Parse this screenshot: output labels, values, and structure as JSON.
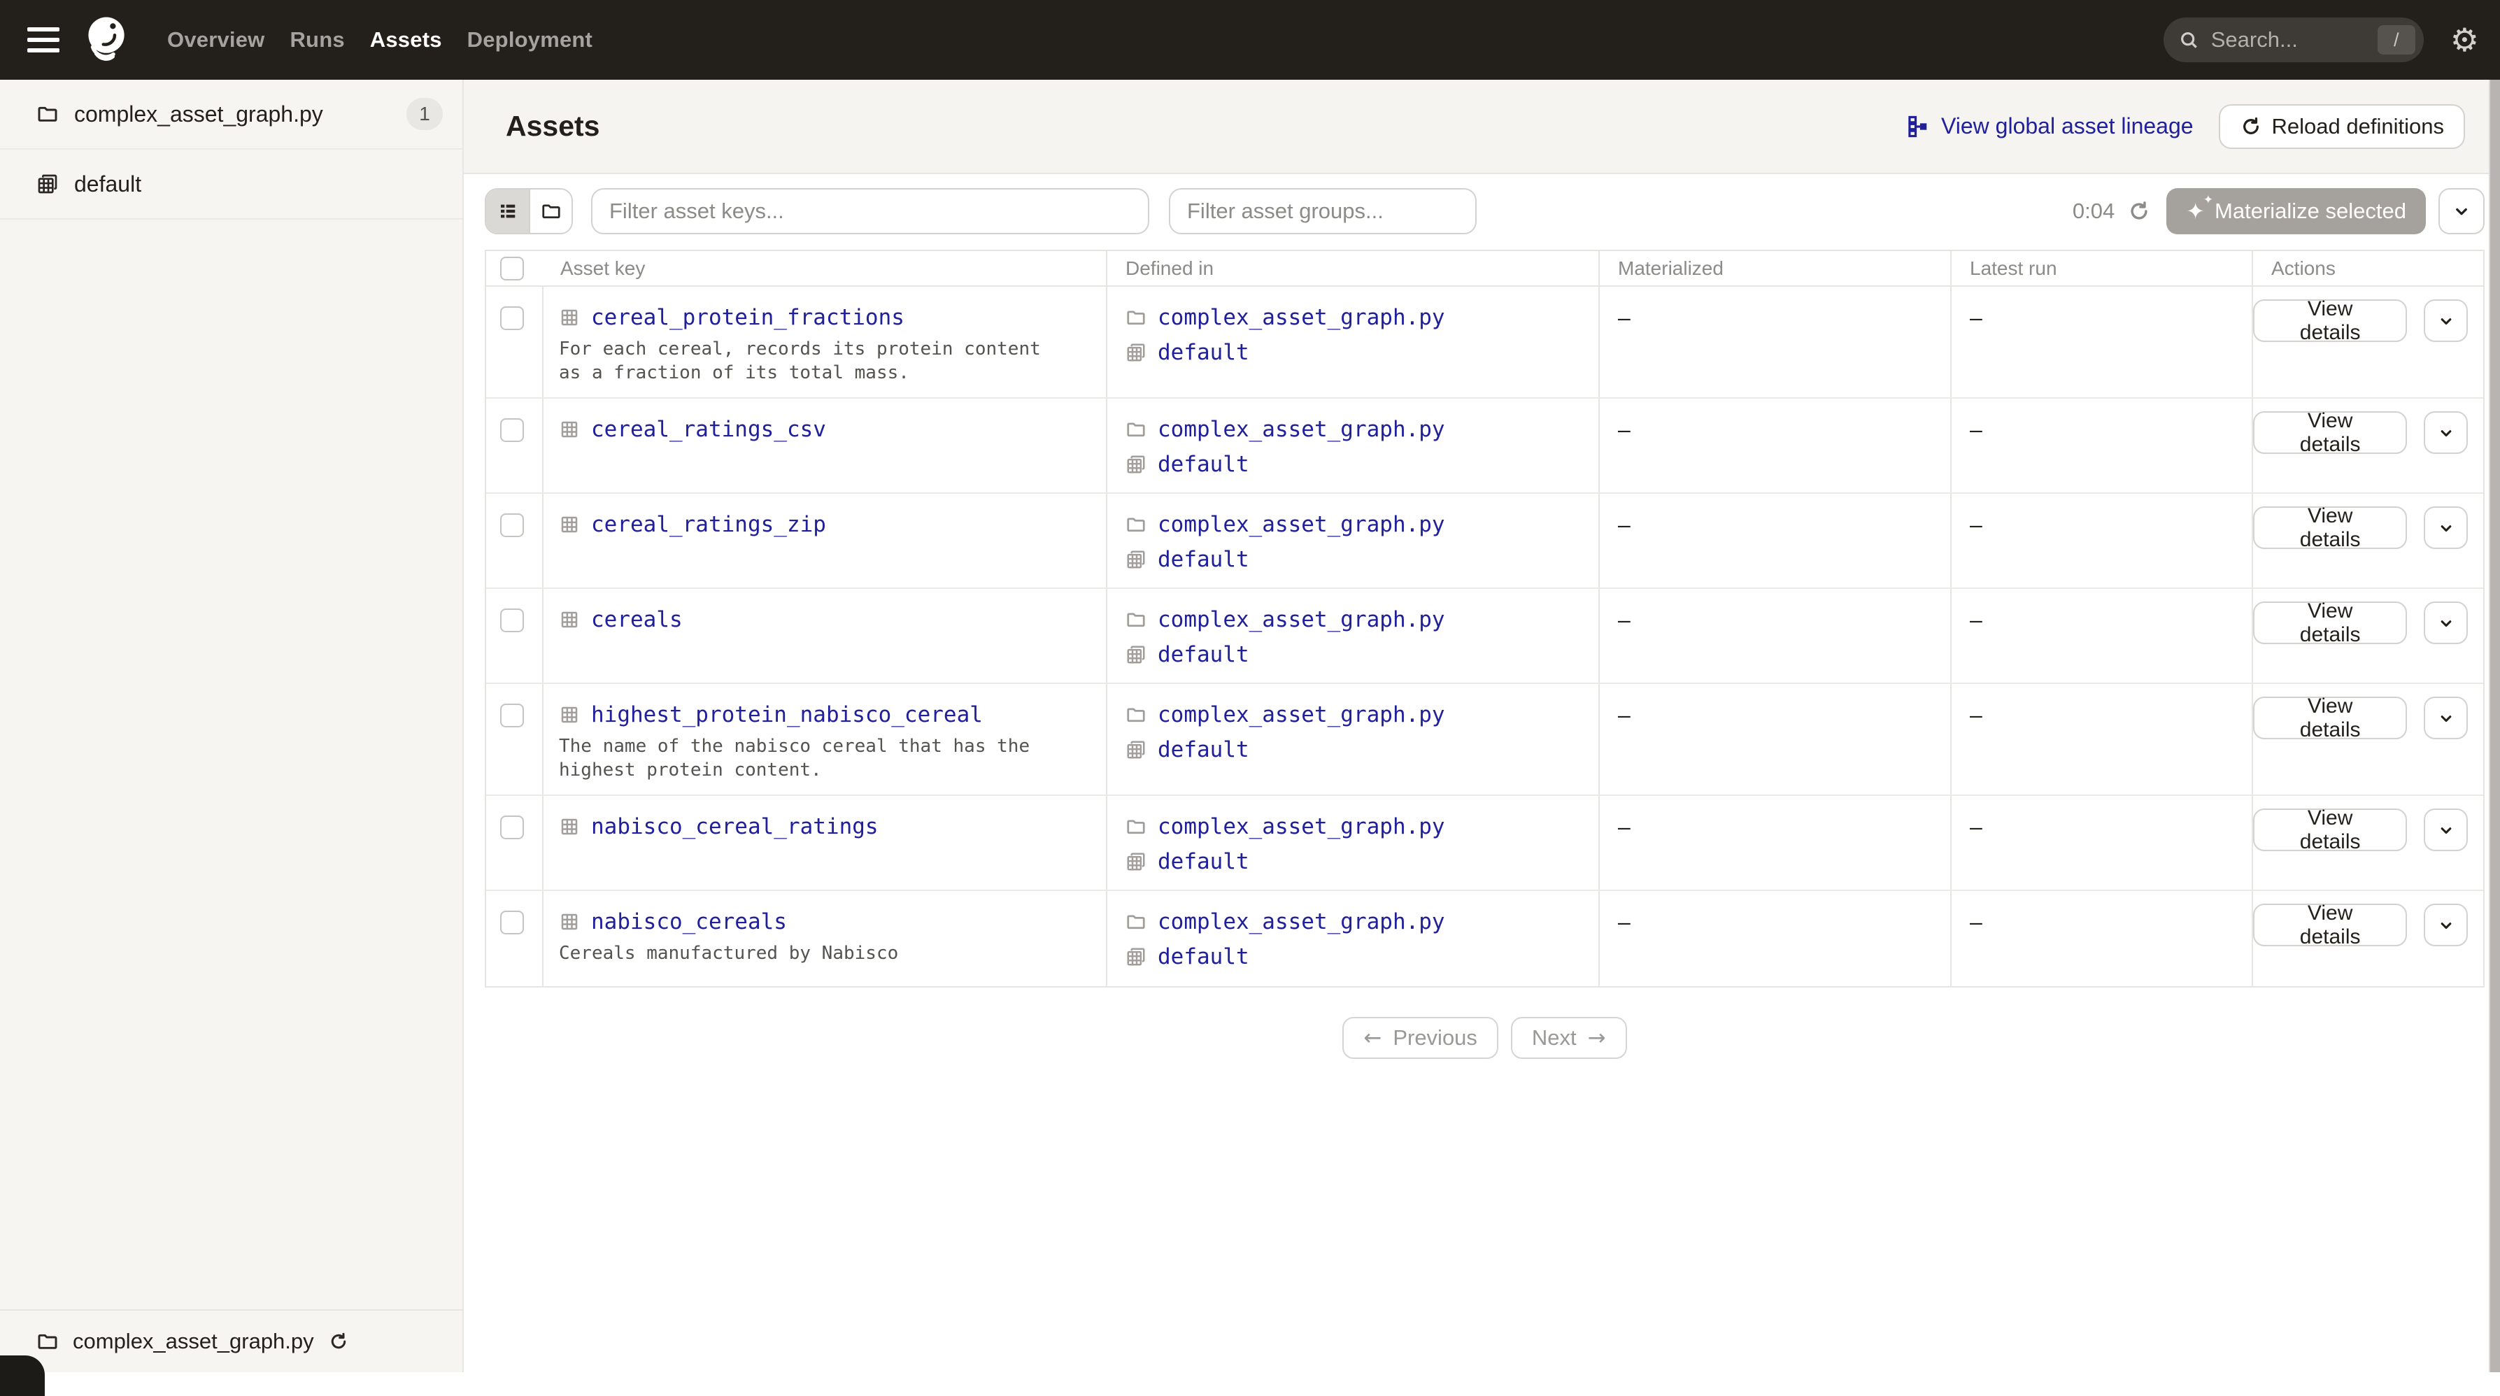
{
  "nav": {
    "items": [
      {
        "label": "Overview",
        "active": false
      },
      {
        "label": "Runs",
        "active": false
      },
      {
        "label": "Assets",
        "active": true
      },
      {
        "label": "Deployment",
        "active": false
      }
    ],
    "search": {
      "placeholder": "Search...",
      "shortcut": "/"
    }
  },
  "sidebar": {
    "groups": [
      {
        "label": "complex_asset_graph.py",
        "icon": "folder-icon",
        "badge": "1"
      },
      {
        "label": "default",
        "icon": "asset-group-icon",
        "badge": ""
      }
    ],
    "footer": {
      "label": "complex_asset_graph.py"
    }
  },
  "header": {
    "title": "Assets",
    "lineage_link": "View global asset lineage",
    "reload_button": "Reload definitions"
  },
  "toolbar": {
    "filter_keys_placeholder": "Filter asset keys...",
    "filter_groups_placeholder": "Filter asset groups...",
    "timer": "0:04",
    "materialize_button": "Materialize selected"
  },
  "table": {
    "columns": [
      "Asset key",
      "Defined in",
      "Materialized",
      "Latest run",
      "Actions"
    ],
    "view_details_label": "View details",
    "rows": [
      {
        "key": "cereal_protein_fractions",
        "description": "For each cereal, records its protein content as a fraction of its total mass.",
        "defined_in": "complex_asset_graph.py",
        "group": "default",
        "materialized": "–",
        "latest_run": "–"
      },
      {
        "key": "cereal_ratings_csv",
        "description": "",
        "defined_in": "complex_asset_graph.py",
        "group": "default",
        "materialized": "–",
        "latest_run": "–"
      },
      {
        "key": "cereal_ratings_zip",
        "description": "",
        "defined_in": "complex_asset_graph.py",
        "group": "default",
        "materialized": "–",
        "latest_run": "–"
      },
      {
        "key": "cereals",
        "description": "",
        "defined_in": "complex_asset_graph.py",
        "group": "default",
        "materialized": "–",
        "latest_run": "–"
      },
      {
        "key": "highest_protein_nabisco_cereal",
        "description": "The name of the nabisco cereal that has the highest protein content.",
        "defined_in": "complex_asset_graph.py",
        "group": "default",
        "materialized": "–",
        "latest_run": "–"
      },
      {
        "key": "nabisco_cereal_ratings",
        "description": "",
        "defined_in": "complex_asset_graph.py",
        "group": "default",
        "materialized": "–",
        "latest_run": "–"
      },
      {
        "key": "nabisco_cereals",
        "description": "Cereals manufactured by Nabisco",
        "defined_in": "complex_asset_graph.py",
        "group": "default",
        "materialized": "–",
        "latest_run": "–"
      }
    ]
  },
  "pagination": {
    "previous": "Previous",
    "next": "Next",
    "prev_arrow": "←",
    "next_arrow": "→"
  },
  "colors": {
    "nav_bg": "#231f1b",
    "link_blue": "#21209c",
    "sidebar_bg": "#f7f5f2",
    "header_bg": "#f6f4f1",
    "border": "#d4d2cf",
    "table_border": "#e7e5e2",
    "muted_text": "#8d8b88",
    "disabled_button_bg": "#a5a29e"
  }
}
